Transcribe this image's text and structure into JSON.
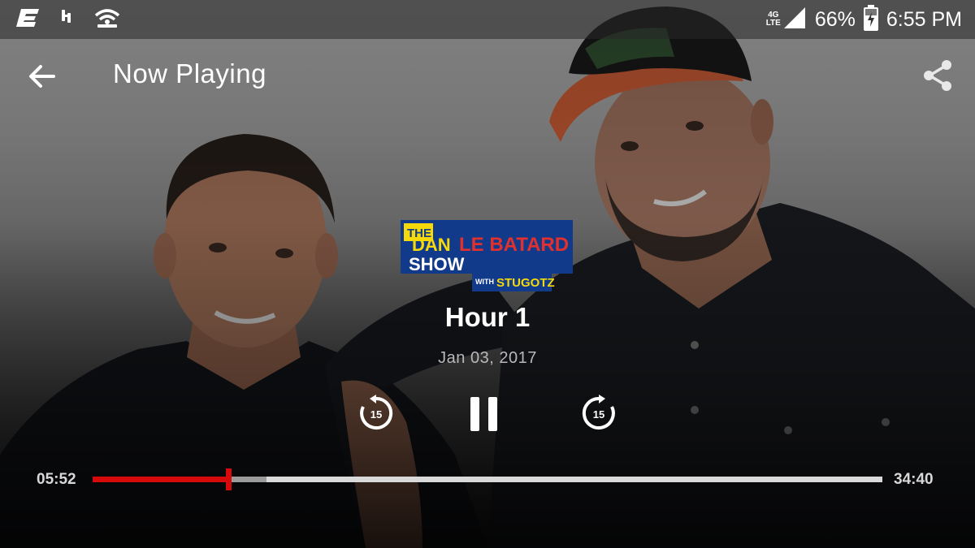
{
  "status_bar": {
    "network_type": "4G LTE",
    "network_top": "4G",
    "network_bottom": "LTE",
    "battery_percent": "66%",
    "time": "6:55 PM",
    "icons": [
      "espn-app-icon",
      "headset-icon",
      "wifi-hotspot-icon",
      "signal-icon",
      "battery-charging-icon"
    ]
  },
  "app_bar": {
    "title": "Now Playing",
    "back_icon": "arrow-left-icon",
    "share_icon": "share-icon"
  },
  "episode": {
    "title": "Hour 1",
    "date": "Jan 03, 2017",
    "show_logo": {
      "line1_a": "THE",
      "line1_b": "DAN",
      "line1_c": "LE BATARD",
      "line2": "SHOW",
      "with": "WITH",
      "cohost": "STUGOTZ"
    }
  },
  "controls": {
    "rewind_seconds": "15",
    "forward_seconds": "15",
    "state": "playing"
  },
  "progress": {
    "elapsed": "05:52",
    "total": "34:40",
    "played_fraction": 0.172,
    "buffered_fraction": 0.22
  },
  "colors": {
    "accent": "#d60a0a",
    "track": "#d9d9d9",
    "buffer": "#9b9b9b"
  }
}
